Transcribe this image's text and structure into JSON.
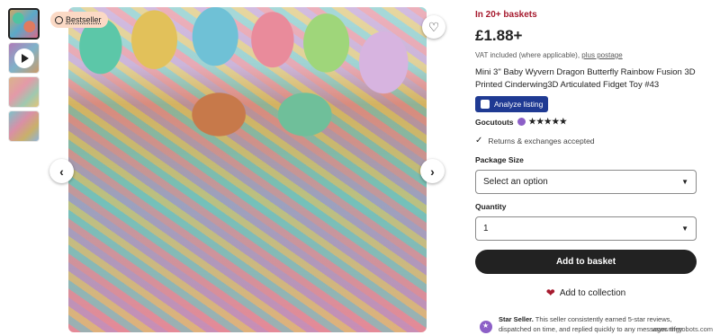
{
  "gallery": {
    "thumbnails": [
      {
        "kind": "image",
        "active": true
      },
      {
        "kind": "video"
      },
      {
        "kind": "image"
      },
      {
        "kind": "image"
      }
    ],
    "badge": "Bestseller",
    "nav_prev_icon": "chevron-left-icon",
    "nav_next_icon": "chevron-right-icon",
    "favorite_icon": "heart-outline-icon"
  },
  "listing": {
    "in_baskets": "In 20+ baskets",
    "price": "£1.88+",
    "vat_text": "VAT included (where applicable),",
    "vat_link": "plus postage",
    "title": "Mini 3\" Baby Wyvern Dragon Butterfly Rainbow Fusion 3D Printed Cinderwing3D Articulated Fidget Toy #43",
    "analyze_label": "Analyze listing",
    "shop_name": "Gocutouts",
    "stars": "★★★★★",
    "returns": "Returns & exchanges accepted"
  },
  "form": {
    "package_label": "Package Size",
    "package_value": "Select an option",
    "quantity_label": "Quantity",
    "quantity_value": "1",
    "add_to_basket": "Add to basket",
    "add_to_collection": "Add to collection"
  },
  "star_seller": {
    "title": "Star Seller.",
    "text": "This seller consistently earned 5-star reviews, dispatched on time, and replied quickly to any messages they received."
  },
  "watermark": "www.mfgrobots.com",
  "colors": {
    "accent_red": "#a61a2e",
    "badge_bg": "#fbd9c5",
    "analyze_bg": "#1f3a93",
    "star_seller_purple": "#8c5fc7",
    "button_dark": "#222222"
  }
}
